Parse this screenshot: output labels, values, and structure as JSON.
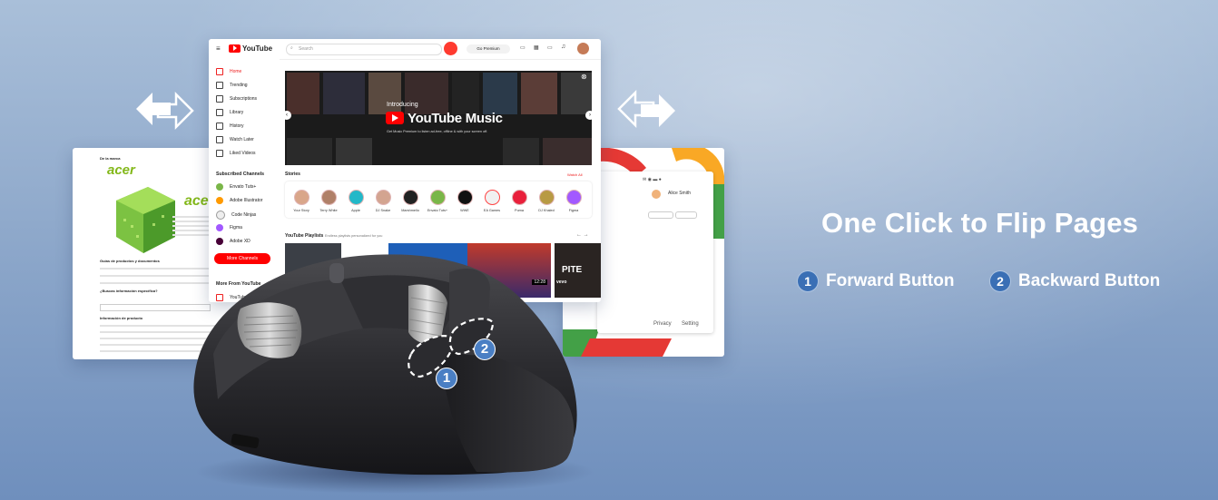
{
  "headline": "One Click to Flip Pages",
  "labels": {
    "forward": {
      "num": "1",
      "text": "Forward Button"
    },
    "backward": {
      "num": "2",
      "text": "Backward Button"
    }
  },
  "mouse_badges": {
    "forward": "1",
    "backward": "2"
  },
  "youtube": {
    "brand": "YouTube",
    "search_placeholder": "Search",
    "premium_btn": "Go Premium",
    "sidebar": {
      "items": [
        "Home",
        "Trending",
        "Subscriptions",
        "Library",
        "History",
        "Watch Later",
        "Liked Videos"
      ],
      "subscribed_header": "Subscribed Channels",
      "channels": [
        "Envato Tuts+",
        "Adobe Illustrator",
        "Code Ninjas",
        "Figma",
        "Adobe XD"
      ],
      "more_channels": "More Channels",
      "more_from": "More From YouTube",
      "premium_item": "YouTube Premium"
    },
    "hero": {
      "introducing": "Introducing",
      "product": "YouTube Music",
      "sub": "Get Music Premium to listen ad-free, offline & with your screen off."
    },
    "stories_title": "Stories",
    "watch_all": "Watch All",
    "stories": [
      "Your Story",
      "Terry White",
      "Apple",
      "DJ Snake",
      "Marshmello",
      "Envato Tuts+",
      "WWE",
      "EA Games",
      "Puma",
      "DJ Khaled",
      "Figma"
    ],
    "playlists_title": "YouTube Playlists",
    "playlists_sub": "Endless playlists personalized for you",
    "thumb_time": "12:28",
    "thumb_word": "PITE",
    "thumb_vevo": "vevo"
  },
  "acer_page": {
    "brand": "acer",
    "crumb": "De la marca",
    "section1": "Guías de productos y documentos",
    "question": "¿Buscas información específica?",
    "info": "Información de producto"
  },
  "google_page": {
    "user": "Alice Smith",
    "privacy": "Privacy",
    "settings": "Setting"
  },
  "colors": {
    "youtube_red": "#ff0000",
    "badge_blue": "#3a6fb5"
  }
}
